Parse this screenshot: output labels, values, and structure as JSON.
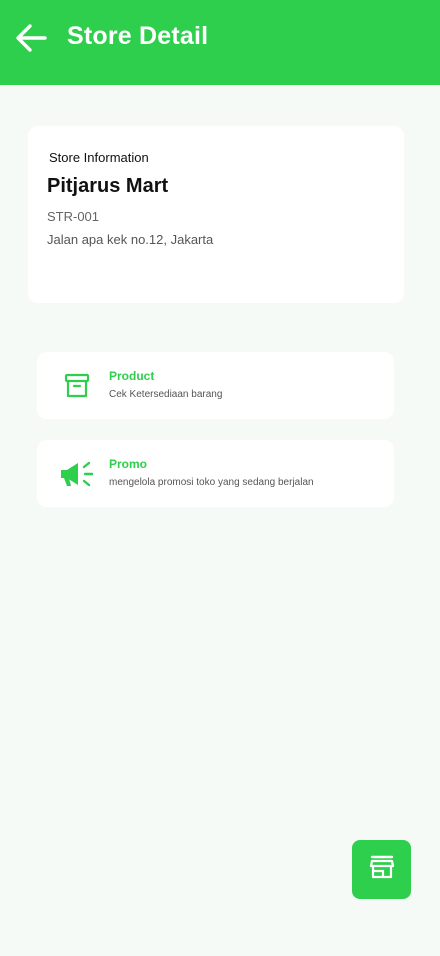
{
  "header": {
    "title": "Store Detail",
    "back_icon": "arrow-left-icon"
  },
  "store": {
    "section_label": "Store Information",
    "name": "Pitjarus Mart",
    "code": "STR-001",
    "address": "Jalan apa kek no.12, Jakarta"
  },
  "menu": [
    {
      "title": "Product",
      "description": "Cek Ketersediaan barang",
      "icon": "archive-box-icon"
    },
    {
      "title": "Promo",
      "description": "mengelola promosi toko yang sedang berjalan",
      "icon": "megaphone-icon"
    }
  ],
  "fab": {
    "icon": "store-icon"
  },
  "colors": {
    "accent": "#2ecf4c",
    "background": "#f5faf6",
    "card": "#ffffff"
  }
}
